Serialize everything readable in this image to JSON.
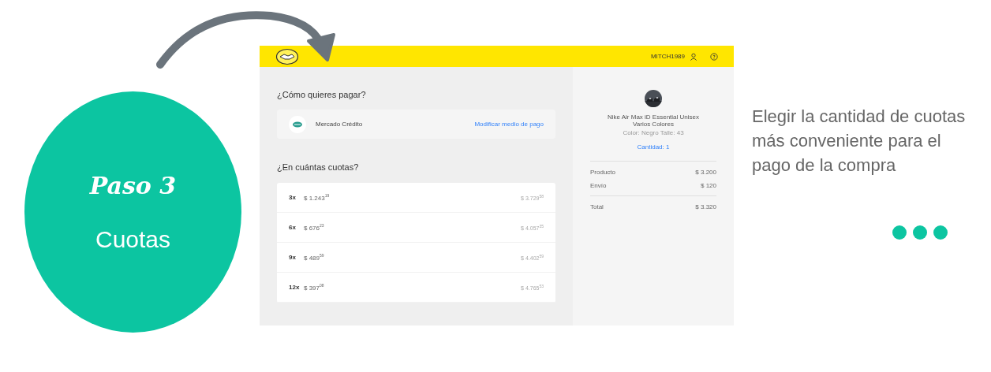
{
  "step": {
    "title": "Paso 3",
    "subtitle": "Cuotas"
  },
  "screen": {
    "header": {
      "username": "MITCH1989"
    },
    "payment": {
      "heading": "¿Cómo quieres pagar?",
      "method": "Mercado Crédito",
      "link": "Modificar medio de pago"
    },
    "installments": {
      "heading": "¿En cuántas cuotas?",
      "options": [
        {
          "count": "3x",
          "amount": "$ 1.243$^{19}$",
          "total": "$ 3.729$^{58}$"
        },
        {
          "count": "6x",
          "amount": "$ 676$^{23}$",
          "total": "$ 4.057$^{35}$"
        },
        {
          "count": "9x",
          "amount": "$ 489$^{59}$",
          "total": "$ 4.402$^{59}$"
        },
        {
          "count": "12x",
          "amount": "$ 397$^{08}$",
          "total": "$ 4.765$^{53}$"
        }
      ]
    },
    "summary": {
      "product_name": "Nike Air Max iD Essential Unisex",
      "variant": "Varios Colores",
      "details": "Color: Negro  Talle: 43",
      "quantity": "Cantidad: 1",
      "lines": [
        {
          "label": "Producto",
          "value": "$ 3.200"
        },
        {
          "label": "Envío",
          "value": "$ 120"
        }
      ],
      "total": {
        "label": "Total",
        "value": "$ 3.320"
      }
    }
  },
  "description": "Elegir la cantidad de cuotas más conveniente para el pago de la compra"
}
